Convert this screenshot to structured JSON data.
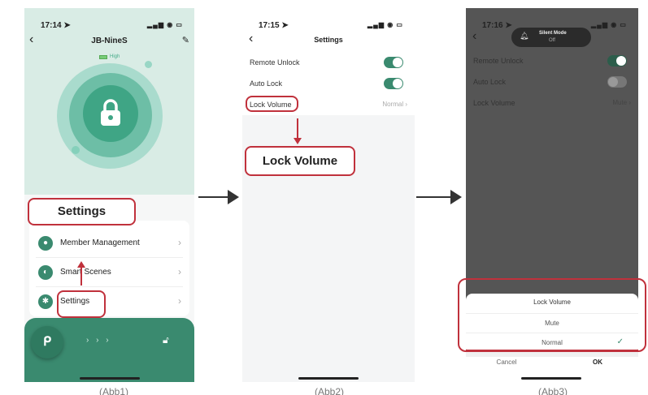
{
  "screen1": {
    "status_time": "17:14 ➤",
    "status_icons": "▂▄▆ ◉ ▭",
    "title": "JB-NineS",
    "back": "‹",
    "edit": "✎",
    "battery_label": "High",
    "callout": "Settings",
    "menu": [
      {
        "label": "Member Management",
        "chevron": "›"
      },
      {
        "label": "Smart Scenes",
        "chevron": "›"
      },
      {
        "label": "Settings",
        "chevron": "›"
      }
    ],
    "swipe_hint": "› › ›",
    "caption": "(Abb1)"
  },
  "screen2": {
    "status_time": "17:15 ➤",
    "status_icons": "▂▄▆ ◉ ▭",
    "back": "‹",
    "title": "Settings",
    "rows": [
      {
        "label": "Remote Unlock",
        "toggle": "on"
      },
      {
        "label": "Auto Lock",
        "toggle": "on"
      },
      {
        "label": "Lock Volume",
        "value": "Normal ›"
      }
    ],
    "callout": "Lock Volume",
    "caption": "(Abb2)"
  },
  "screen3": {
    "status_time": "17:16 ➤",
    "status_icons": "▂▄▆ ◉ ▭",
    "back": "‹",
    "toast_title": "Silent Mode",
    "toast_sub": "Off",
    "rows": [
      {
        "label": "Remote Unlock",
        "toggle": "on"
      },
      {
        "label": "Auto Lock",
        "toggle": "off"
      },
      {
        "label": "Lock Volume",
        "value": "Mute ›"
      }
    ],
    "sheet_title": "Lock Volume",
    "options": [
      {
        "label": "Mute",
        "selected": false
      },
      {
        "label": "Normal",
        "selected": true
      }
    ],
    "check": "✓",
    "cancel": "Cancel",
    "ok": "OK",
    "caption": "(Abb3)"
  },
  "colors": {
    "accent": "#3a8a6f",
    "callout_red": "#c0313c",
    "overlay": "#555555"
  }
}
